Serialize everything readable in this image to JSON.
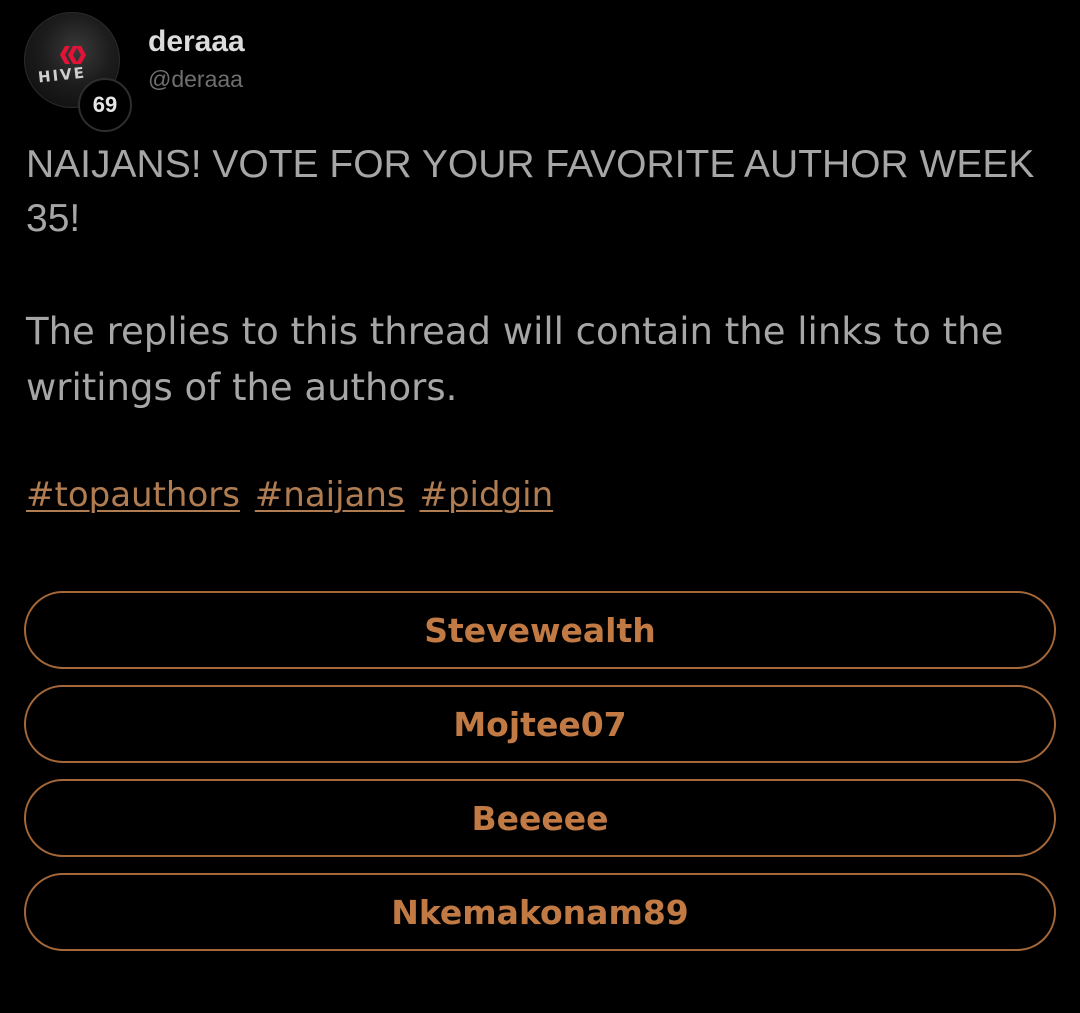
{
  "post": {
    "author": {
      "display_name": "deraaa",
      "handle": "@deraaa",
      "level": "69",
      "avatar_text": "HIVE"
    },
    "title": "NAIJANS! VOTE FOR YOUR FAVORITE AUTHOR WEEK 35!",
    "body": "The replies to this thread will contain the links to the writings of the authors.",
    "hashtags": [
      "#topauthors",
      "#naijans",
      "#pidgin"
    ],
    "poll": {
      "options": [
        "Stevewealth",
        "Mojtee07",
        "Beeeee",
        "Nkemakonam89"
      ]
    }
  },
  "colors": {
    "background": "#000000",
    "text": "#a6a6a6",
    "accent": "#c27a44",
    "poll_border": "#a3673a",
    "hive_logo": "#e31337"
  }
}
